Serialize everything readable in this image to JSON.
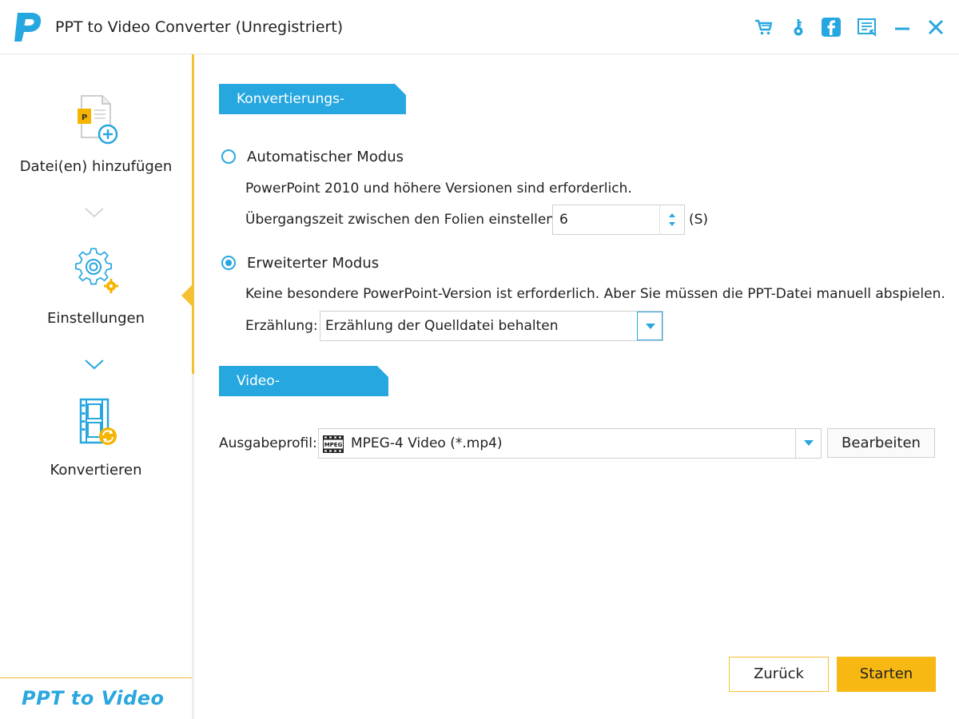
{
  "window": {
    "title": "PPT to Video Converter (Unregistriert)",
    "logo_letter": "P",
    "controls": [
      "cart-icon",
      "key-icon",
      "facebook-icon",
      "feedback-icon",
      "minimize-icon",
      "close-icon"
    ]
  },
  "sidebar": {
    "steps": [
      {
        "label": "Datei(en) hinzufügen",
        "icon": "add-file-icon",
        "active": false
      },
      {
        "label": "Einstellungen",
        "icon": "settings-gear-icon",
        "active": true
      },
      {
        "label": "Konvertieren",
        "icon": "convert-film-icon",
        "active": false
      }
    ],
    "brand": "PPT to Video"
  },
  "conversion_mode": {
    "header": "Konvertierungs-Modus:",
    "automatic": {
      "label": "Automatischer Modus",
      "selected": false,
      "description": "PowerPoint 2010 und höhere Versionen sind erforderlich.",
      "transition_label": "Übergangszeit zwischen den Folien einstellen:",
      "transition_value": "6",
      "transition_unit": "(S)"
    },
    "advanced": {
      "label": "Erweiterter Modus",
      "selected": true,
      "description": "Keine besondere PowerPoint-Version ist erforderlich. Aber Sie müssen die PPT-Datei manuell abspielen.",
      "narration_label": "Erzählung:",
      "narration_value": "Erzählung der Quelldatei behalten"
    }
  },
  "video_settings": {
    "header": "Video-Einstellungen:",
    "profile_label": "Ausgabeprofil:",
    "profile_icon_text": "MPEG",
    "profile_value": "MPEG-4 Video (*.mp4)",
    "edit_button": "Bearbeiten"
  },
  "footer": {
    "back_button": "Zurück",
    "start_button": "Starten"
  },
  "colors": {
    "accent_blue": "#27a7e0",
    "accent_yellow": "#f5c031",
    "start_button": "#f7b813"
  }
}
